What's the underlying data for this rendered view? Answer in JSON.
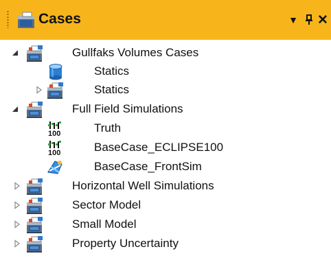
{
  "panel": {
    "title": "Cases",
    "buttons": {
      "dropdown": "▾",
      "pin": "1",
      "close": "✕"
    }
  },
  "tree": {
    "gullfaks": {
      "label": "Gullfaks Volumes Cases",
      "expanded": true,
      "icon": "case-folder-icon"
    },
    "gullfaks_statics_1": {
      "label": "Statics",
      "icon": "statics-cylinder-icon"
    },
    "gullfaks_statics_2": {
      "label": "Statics",
      "expanded": false,
      "icon": "case-folder-icon"
    },
    "fullfield": {
      "label": "Full Field Simulations",
      "expanded": true,
      "icon": "case-folder-icon"
    },
    "truth": {
      "label": "Truth",
      "icon": "simulation-grid-icon"
    },
    "basecase_eclipse": {
      "label": "BaseCase_ECLIPSE100",
      "icon": "simulation-grid-icon"
    },
    "basecase_frontsim": {
      "label": "BaseCase_FrontSim",
      "icon": "frontsim-icon"
    },
    "horizontal": {
      "label": "Horizontal Well Simulations",
      "expanded": false,
      "icon": "case-folder-icon"
    },
    "sector": {
      "label": "Sector Model",
      "expanded": false,
      "icon": "case-folder-icon"
    },
    "small": {
      "label": "Small Model",
      "expanded": false,
      "icon": "case-folder-icon"
    },
    "property": {
      "label": "Property Uncertainty",
      "expanded": false,
      "icon": "case-folder-icon"
    }
  },
  "colors": {
    "titlebar": "#f7b51b",
    "folder_blue": "#1f6fc4",
    "folder_gray": "#7a8a99"
  }
}
